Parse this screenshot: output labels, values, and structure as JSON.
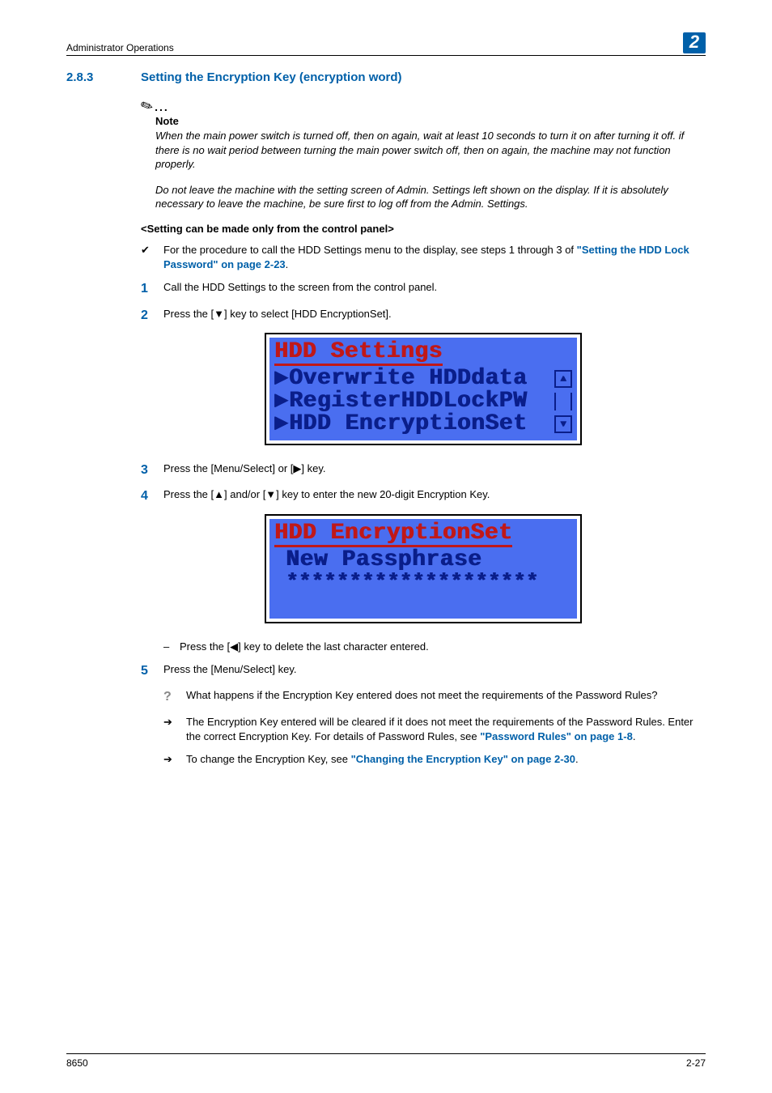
{
  "header": {
    "section": "Administrator Operations",
    "chapter": "2"
  },
  "heading": {
    "number": "2.8.3",
    "title": "Setting the Encryption Key (encryption word)"
  },
  "note": {
    "label": "Note",
    "p1": "When the main power switch is turned off, then on again, wait at least 10 seconds to turn it on after turning it off. if there is no wait period between turning the main power switch off, then on again, the machine may not function properly.",
    "p2": "Do not leave the machine with the setting screen of Admin. Settings left shown on the display. If it is absolutely necessary to leave the machine, be sure first to log off from the Admin. Settings."
  },
  "subhead": "<Setting can be made only from the control panel>",
  "bullet": {
    "pre": "For the procedure to call the HDD Settings menu to the display, see steps 1 through 3 of ",
    "link": "\"Setting the HDD Lock Password\" on page 2-23",
    "post": "."
  },
  "steps": {
    "s1": "Call the HDD Settings to the screen from the control panel.",
    "s2": "Press the [▼] key to select [HDD EncryptionSet].",
    "s3": "Press the [Menu/Select] or [▶] key.",
    "s4": "Press the [▲] and/or [▼] key to enter the new 20-digit Encryption Key.",
    "s4a": "Press the [◀] key to delete the last character entered.",
    "s5": "Press the [Menu/Select] key.",
    "q": "What happens if the Encryption Key entered does not meet the requirements of the Password Rules?",
    "a_pre": "The Encryption Key entered will be cleared if it does not meet the requirements of the Password Rules. Enter the correct Encryption Key. For details of Password Rules, see ",
    "a_link": "\"Password Rules\" on page 1-8",
    "a_post": ".",
    "c_pre": "To change the Encryption Key, see ",
    "c_link": "\"Changing the Encryption Key\" on page 2-30",
    "c_post": "."
  },
  "lcd1": {
    "title": "HDD Settings",
    "r1": "Overwrite HDDdata",
    "r2": "RegisterHDDLockPW",
    "r3": "HDD EncryptionSet"
  },
  "lcd2": {
    "title": "HDD EncryptionSet",
    "r1": "New Passphrase",
    "r2": "********************"
  },
  "footer": {
    "left": "8650",
    "right": "2-27"
  }
}
